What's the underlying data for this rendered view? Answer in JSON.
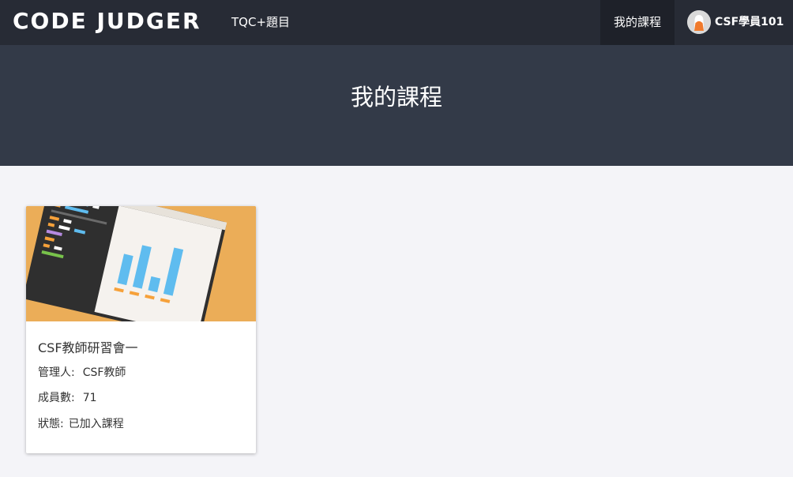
{
  "navbar": {
    "brand": "CODE JUDGER",
    "link_tqc": "TQC+題目",
    "my_courses": "我的課程",
    "user_name": "CSF學員101",
    "avatar_icon": "user-avatar-icon"
  },
  "hero": {
    "title": "我的課程"
  },
  "courses": [
    {
      "title": "CSF教師研習會一",
      "manager_label": "管理人:",
      "manager": "CSF教師",
      "members_label": "成員數:",
      "members": "71",
      "status_label": "狀態:",
      "status": "已加入課程",
      "image_icon": "code-and-chart-illustration"
    }
  ],
  "colors": {
    "navbar_bg": "#272b35",
    "hero_bg": "#333a48",
    "page_bg": "#f4f4f8",
    "card_image_bg": "#ebad58",
    "chart_bar": "#5fbcef"
  }
}
